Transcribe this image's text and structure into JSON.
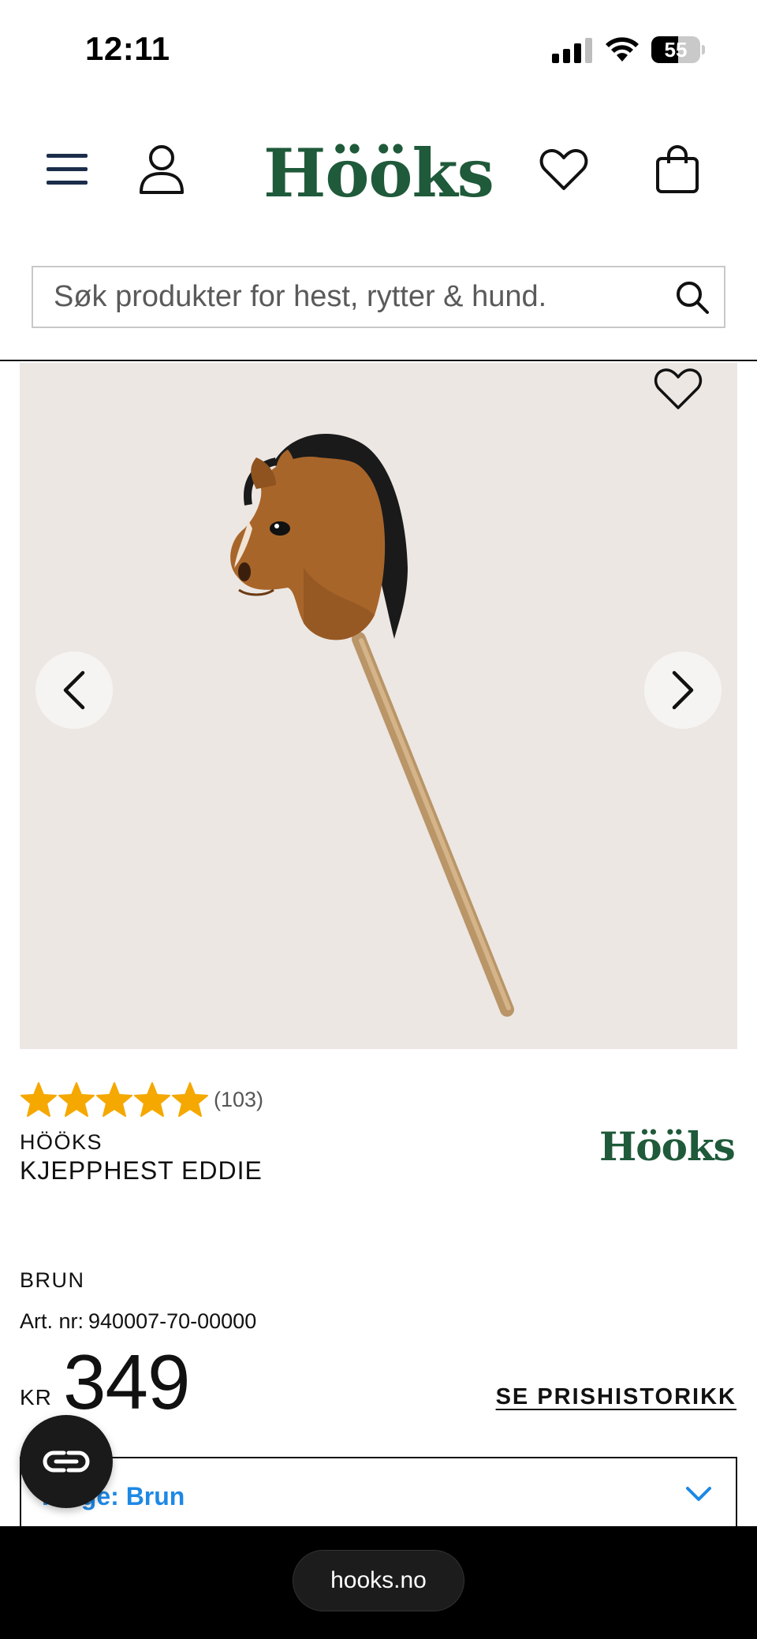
{
  "status_bar": {
    "time": "12:11",
    "battery_level": "55"
  },
  "header": {
    "logo_text": "Hööks",
    "icons": [
      "menu-icon",
      "user-icon",
      "heart-icon",
      "bag-icon"
    ],
    "logo_color": "#1f5a3a"
  },
  "search": {
    "placeholder": "Søk produkter for hest, rytter & hund."
  },
  "product": {
    "rating_stars": 5,
    "rating_count": "(103)",
    "brand": "HÖÖKS",
    "name": "KJEPPHEST EDDIE",
    "brand_logo_text": "Hööks",
    "color_name": "BRUN",
    "artnr_label": "Art. nr:",
    "artnr_value": "940007-70-00000",
    "currency": "KR",
    "price": "349",
    "price_history_link": "SE PRISHISTORIKK",
    "color_select_label": "Farge: Brun",
    "star_color": "#f5a800",
    "accent_color": "#1e88e5"
  },
  "browser": {
    "url": "hooks.no"
  }
}
